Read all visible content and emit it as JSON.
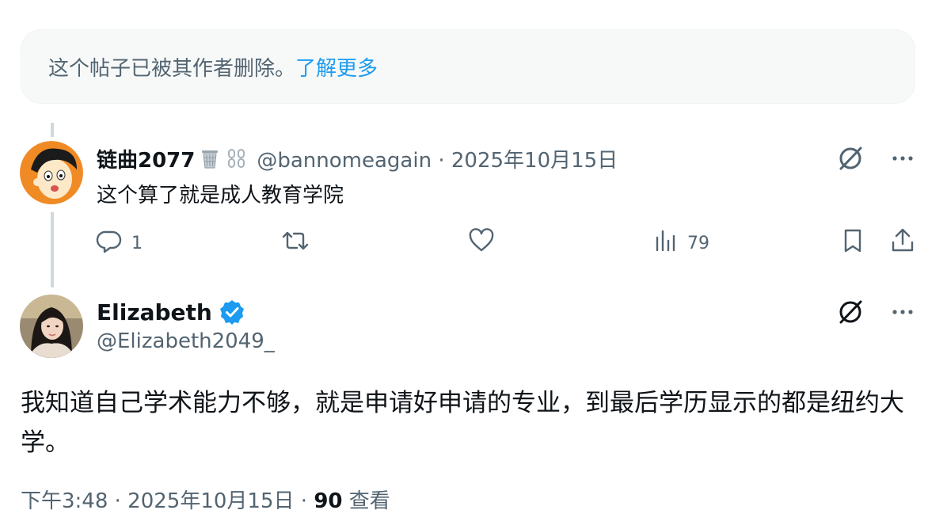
{
  "deleted_notice": {
    "text": "这个帖子已被其作者删除。",
    "link": "了解更多"
  },
  "reply": {
    "display_name": "链曲2077",
    "name_emojis": [
      "wastebasket-icon",
      "chain-icon"
    ],
    "meta": "@bannomeagain · 2025年10月15日",
    "text": "这个算了就是成人教育学院",
    "actions": {
      "replies": "1",
      "views": "79"
    }
  },
  "main_post": {
    "display_name": "Elizabeth",
    "handle": "@Elizabeth2049_",
    "text": "我知道自己学术能力不够，就是申请好申请的专业，到最后学历显示的都是纽约大学。",
    "footer_meta": "下午3:48 · 2025年10月15日 · ",
    "views_count": "90",
    "views_label": "查看"
  },
  "colors": {
    "accent": "#1d9bf0",
    "text_primary": "#0f1419",
    "text_secondary": "#536471",
    "notice_background": "#f7f9f9",
    "thread_line": "#cfd9de"
  }
}
